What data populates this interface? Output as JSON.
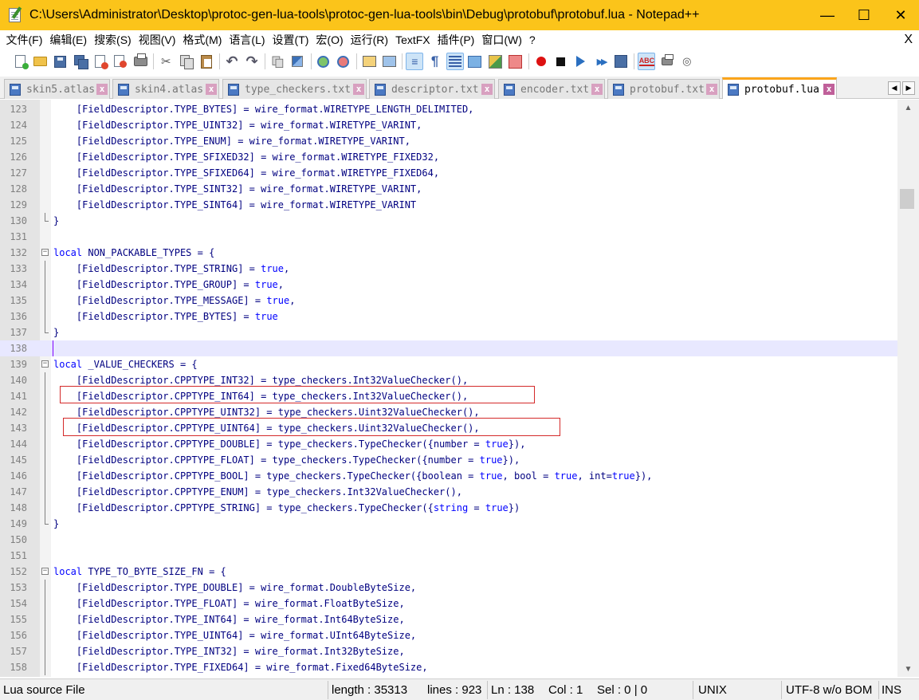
{
  "window": {
    "title": "C:\\Users\\Administrator\\Desktop\\protoc-gen-lua-tools\\protoc-gen-lua-tools\\bin\\Debug\\protobuf\\protobuf.lua - Notepad++",
    "minimize": "—",
    "maximize": "☐",
    "close": "✕"
  },
  "menu": {
    "items": [
      "文件(F)",
      "编辑(E)",
      "搜索(S)",
      "视图(V)",
      "格式(M)",
      "语言(L)",
      "设置(T)",
      "宏(O)",
      "运行(R)",
      "TextFX",
      "插件(P)",
      "窗口(W)",
      "?"
    ],
    "close": "X"
  },
  "toolbar": {
    "icons": [
      "new-file-icon",
      "open-file-icon",
      "save-icon",
      "save-all-icon",
      "close-icon",
      "close-all-icon",
      "print-icon",
      "cut-icon",
      "copy-icon",
      "paste-icon",
      "undo-icon",
      "redo-icon",
      "find-icon",
      "replace-icon",
      "zoom-in-icon",
      "zoom-out-icon",
      "sync-vertical-icon",
      "sync-horizontal-icon",
      "word-wrap-icon",
      "show-all-chars-icon",
      "indent-guide-icon",
      "fold-icon",
      "language-icon",
      "function-list-icon",
      "record-macro-icon",
      "stop-macro-icon",
      "play-macro-icon",
      "play-macro-multiple-icon",
      "save-macro-icon",
      "spell-check-icon",
      "document-map-icon",
      "monitor-icon"
    ],
    "undo_glyph": "↶",
    "redo_glyph": "↷",
    "cut_glyph": "✂",
    "spell_text": "ABC"
  },
  "tabs": [
    {
      "label": "skin5.atlas",
      "active": false
    },
    {
      "label": "skin4.atlas",
      "active": false
    },
    {
      "label": "type_checkers.txt",
      "active": false
    },
    {
      "label": "descriptor.txt",
      "active": false
    },
    {
      "label": "encoder.txt",
      "active": false
    },
    {
      "label": "protobuf.txt",
      "active": false
    },
    {
      "label": "protobuf.lua",
      "active": true
    }
  ],
  "tab_close_glyph": "x",
  "tab_nav": {
    "left": "◀",
    "right": "▶"
  },
  "editor": {
    "current_line": 138,
    "lines": [
      {
        "n": "123",
        "t": "    [FieldDescriptor.TYPE_BYTES] = wire_format.WIRETYPE_LENGTH_DELIMITED,"
      },
      {
        "n": "124",
        "t": "    [FieldDescriptor.TYPE_UINT32] = wire_format.WIRETYPE_VARINT,"
      },
      {
        "n": "125",
        "t": "    [FieldDescriptor.TYPE_ENUM] = wire_format.WIRETYPE_VARINT,"
      },
      {
        "n": "126",
        "t": "    [FieldDescriptor.TYPE_SFIXED32] = wire_format.WIRETYPE_FIXED32,"
      },
      {
        "n": "127",
        "t": "    [FieldDescriptor.TYPE_SFIXED64] = wire_format.WIRETYPE_FIXED64,"
      },
      {
        "n": "128",
        "t": "    [FieldDescriptor.TYPE_SINT32] = wire_format.WIRETYPE_VARINT,"
      },
      {
        "n": "129",
        "t": "    [FieldDescriptor.TYPE_SINT64] = wire_format.WIRETYPE_VARINT"
      },
      {
        "n": "130",
        "t": "}",
        "fold": "end"
      },
      {
        "n": "131",
        "t": ""
      },
      {
        "n": "132",
        "kw": "local",
        "t": " NON_PACKABLE_TYPES = {",
        "fold": "start"
      },
      {
        "n": "133",
        "t": "    [FieldDescriptor.TYPE_STRING] = ",
        "val": "true",
        "tail": ",",
        "fold": "mid"
      },
      {
        "n": "134",
        "t": "    [FieldDescriptor.TYPE_GROUP] = ",
        "val": "true",
        "tail": ",",
        "fold": "mid"
      },
      {
        "n": "135",
        "t": "    [FieldDescriptor.TYPE_MESSAGE] = ",
        "val": "true",
        "tail": ",",
        "fold": "mid"
      },
      {
        "n": "136",
        "t": "    [FieldDescriptor.TYPE_BYTES] = ",
        "val": "true",
        "tail": "",
        "fold": "mid"
      },
      {
        "n": "137",
        "t": "}",
        "fold": "end"
      },
      {
        "n": "138",
        "t": ""
      },
      {
        "n": "139",
        "kw": "local",
        "t": " _VALUE_CHECKERS = {",
        "fold": "start"
      },
      {
        "n": "140",
        "t": "    [FieldDescriptor.CPPTYPE_INT32] = type_checkers.Int32ValueChecker(),",
        "fold": "mid"
      },
      {
        "n": "141",
        "t": "    [FieldDescriptor.CPPTYPE_INT64] = type_checkers.Int32ValueChecker(),",
        "fold": "mid"
      },
      {
        "n": "142",
        "t": "    [FieldDescriptor.CPPTYPE_UINT32] = type_checkers.Uint32ValueChecker(),",
        "fold": "mid"
      },
      {
        "n": "143",
        "t": "    [FieldDescriptor.CPPTYPE_UINT64] = type_checkers.Uint32ValueChecker(),",
        "fold": "mid"
      },
      {
        "n": "144",
        "t": "    [FieldDescriptor.CPPTYPE_DOUBLE] = type_checkers.TypeChecker({number = ",
        "val": "true",
        "tail": "}),",
        "fold": "mid"
      },
      {
        "n": "145",
        "t": "    [FieldDescriptor.CPPTYPE_FLOAT] = type_checkers.TypeChecker({number = ",
        "val": "true",
        "tail": "}),",
        "fold": "mid"
      },
      {
        "n": "146",
        "t": "    [FieldDescriptor.CPPTYPE_BOOL] = type_checkers.TypeChecker({boolean = ",
        "val": "true",
        "tail": ", bool = ",
        "val2": "true",
        "tail2": ", int=",
        "val3": "true",
        "tail3": "}),",
        "fold": "mid"
      },
      {
        "n": "147",
        "t": "    [FieldDescriptor.CPPTYPE_ENUM] = type_checkers.Int32ValueChecker(),",
        "fold": "mid"
      },
      {
        "n": "148",
        "t": "    [FieldDescriptor.CPPTYPE_STRING] = type_checkers.TypeChecker({",
        "kw2": "string",
        "tail": " = ",
        "val": "true",
        "tail2": "})",
        "fold": "mid"
      },
      {
        "n": "149",
        "t": "}",
        "fold": "end"
      },
      {
        "n": "150",
        "t": ""
      },
      {
        "n": "151",
        "t": ""
      },
      {
        "n": "152",
        "kw": "local",
        "t": " TYPE_TO_BYTE_SIZE_FN = {",
        "fold": "start"
      },
      {
        "n": "153",
        "t": "    [FieldDescriptor.TYPE_DOUBLE] = wire_format.DoubleByteSize,",
        "fold": "mid"
      },
      {
        "n": "154",
        "t": "    [FieldDescriptor.TYPE_FLOAT] = wire_format.FloatByteSize,",
        "fold": "mid"
      },
      {
        "n": "155",
        "t": "    [FieldDescriptor.TYPE_INT64] = wire_format.Int64ByteSize,",
        "fold": "mid"
      },
      {
        "n": "156",
        "t": "    [FieldDescriptor.TYPE_UINT64] = wire_format.UInt64ByteSize,",
        "fold": "mid"
      },
      {
        "n": "157",
        "t": "    [FieldDescriptor.TYPE_INT32] = wire_format.Int32ByteSize,",
        "fold": "mid"
      },
      {
        "n": "158",
        "t": "    [FieldDescriptor.TYPE_FIXED64] = wire_format.Fixed64ByteSize,",
        "fold": "mid"
      }
    ]
  },
  "scrollbar": {
    "up": "▲",
    "down": "▼"
  },
  "status": {
    "filetype": "Lua source File",
    "length": "length : 35313",
    "lines": "lines : 923",
    "ln": "Ln : 138",
    "col": "Col : 1",
    "sel": "Sel : 0 | 0",
    "eol": "UNIX",
    "encoding": "UTF-8 w/o BOM",
    "mode": "INS"
  },
  "colors": {
    "titlebar": "#fbc41a",
    "keyword": "#0000ff",
    "code_text": "#000080",
    "current_line": "#e8e8ff",
    "highlight_box": "#d42a2a",
    "active_tab_accent": "#fba41a"
  }
}
